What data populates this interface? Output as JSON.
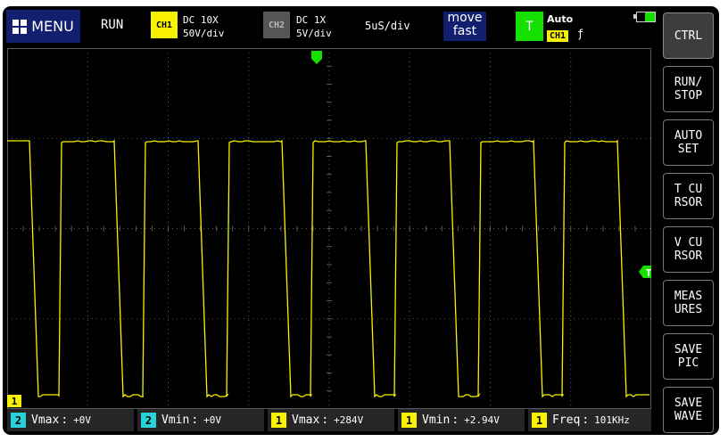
{
  "header": {
    "menu_label": "MENU",
    "run_status": "RUN",
    "ch1": {
      "label": "CH1",
      "coupling": "DC 10X",
      "scale": "50V/div"
    },
    "ch2": {
      "label": "CH2",
      "coupling": "DC 1X",
      "scale": "5V/div"
    },
    "timebase": "5uS/div",
    "move_mode": [
      "move",
      "fast"
    ],
    "trigger": {
      "badge": "T",
      "mode": "Auto",
      "source": "CH1",
      "edge": "ƒ"
    }
  },
  "sidebar": {
    "buttons": [
      {
        "id": "ctrl",
        "label": "CTRL"
      },
      {
        "id": "run-stop",
        "label": "RUN/\nSTOP"
      },
      {
        "id": "auto-set",
        "label": "AUTO\nSET"
      },
      {
        "id": "t-cursor",
        "label": "T CU\nRSOR"
      },
      {
        "id": "v-cursor",
        "label": "V CU\nRSOR"
      },
      {
        "id": "measures",
        "label": "MEAS\nURES"
      },
      {
        "id": "save-pic",
        "label": "SAVE\nPIC"
      },
      {
        "id": "save-wave",
        "label": "SAVE\nWAVE"
      }
    ]
  },
  "measurements": [
    {
      "channel": "2",
      "name": "Vmax",
      "value": "+0V"
    },
    {
      "channel": "2",
      "name": "Vmin",
      "value": "+0V"
    },
    {
      "channel": "1",
      "name": "Vmax",
      "value": "+284V"
    },
    {
      "channel": "1",
      "name": "Vmin",
      "value": "+2.94V"
    },
    {
      "channel": "1",
      "name": "Freq",
      "value": "101KHz"
    }
  ],
  "screen": {
    "ch1_marker": "1",
    "trigger_marker": "T"
  },
  "colors": {
    "ch1": "#f8f200",
    "ch2": "#27d3d8",
    "trigger": "#16e000",
    "grid": "#5a5a5a",
    "panel": "#262626",
    "button_blue": "#111f6e"
  },
  "icons": {
    "menu": "grid-icon",
    "battery": "battery-icon",
    "trigger_edge": "rising-edge-icon"
  }
}
